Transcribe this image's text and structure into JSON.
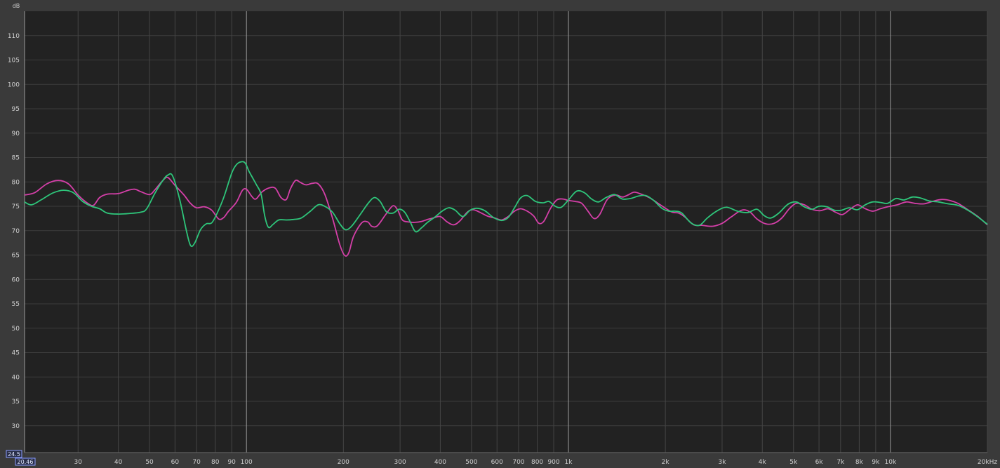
{
  "chart_data": {
    "type": "line",
    "xscale": "log",
    "xlim": [
      20.46,
      20000
    ],
    "ylim": [
      24.5,
      115
    ],
    "ylabel": "dB",
    "grid": true,
    "ytick_values": [
      30,
      35,
      40,
      45,
      50,
      55,
      60,
      65,
      70,
      75,
      80,
      85,
      90,
      95,
      100,
      105,
      110
    ],
    "ytick_labels": [
      "30",
      "35",
      "40",
      "45",
      "50",
      "55",
      "60",
      "65",
      "70",
      "75",
      "80",
      "85",
      "90",
      "95",
      "100",
      "105",
      "110"
    ],
    "xticks": [
      {
        "v": 30,
        "label": "30"
      },
      {
        "v": 40,
        "label": "40"
      },
      {
        "v": 50,
        "label": "50"
      },
      {
        "v": 60,
        "label": "60"
      },
      {
        "v": 70,
        "label": "70"
      },
      {
        "v": 80,
        "label": "80"
      },
      {
        "v": 90,
        "label": "90"
      },
      {
        "v": 100,
        "label": "100"
      },
      {
        "v": 200,
        "label": "200"
      },
      {
        "v": 300,
        "label": "300"
      },
      {
        "v": 400,
        "label": "400"
      },
      {
        "v": 500,
        "label": "500"
      },
      {
        "v": 600,
        "label": "600"
      },
      {
        "v": 700,
        "label": "700"
      },
      {
        "v": 800,
        "label": "800"
      },
      {
        "v": 900,
        "label": "900"
      },
      {
        "v": 1000,
        "label": "1k"
      },
      {
        "v": 2000,
        "label": "2k"
      },
      {
        "v": 3000,
        "label": "3k"
      },
      {
        "v": 4000,
        "label": "4k"
      },
      {
        "v": 5000,
        "label": "5k"
      },
      {
        "v": 6000,
        "label": "6k"
      },
      {
        "v": 7000,
        "label": "7k"
      },
      {
        "v": 8000,
        "label": "8k"
      },
      {
        "v": 9000,
        "label": "9k"
      },
      {
        "v": 10000,
        "label": "10k"
      },
      {
        "v": 20000,
        "label": "20kHz"
      }
    ],
    "major_x": [
      100,
      1000,
      10000
    ],
    "series": [
      {
        "color": "#d43fa8",
        "points": [
          [
            20.46,
            77.3
          ],
          [
            22,
            77.8
          ],
          [
            24,
            79.6
          ],
          [
            26,
            80.3
          ],
          [
            28,
            79.6
          ],
          [
            30,
            77.3
          ],
          [
            32,
            75.7
          ],
          [
            33.5,
            75.2
          ],
          [
            35,
            76.8
          ],
          [
            37,
            77.5
          ],
          [
            40,
            77.6
          ],
          [
            43,
            78.3
          ],
          [
            45,
            78.5
          ],
          [
            47,
            78.0
          ],
          [
            50,
            77.4
          ],
          [
            52,
            78.4
          ],
          [
            55,
            80.3
          ],
          [
            57,
            80.9
          ],
          [
            60,
            79.3
          ],
          [
            64,
            77.3
          ],
          [
            67,
            75.6
          ],
          [
            70,
            74.7
          ],
          [
            74,
            74.9
          ],
          [
            78,
            74.2
          ],
          [
            82,
            72.4
          ],
          [
            85,
            72.7
          ],
          [
            88,
            74.0
          ],
          [
            93,
            75.8
          ],
          [
            97,
            78.2
          ],
          [
            100,
            78.5
          ],
          [
            104,
            77.0
          ],
          [
            107,
            76.5
          ],
          [
            112,
            78.0
          ],
          [
            118,
            78.8
          ],
          [
            123,
            78.7
          ],
          [
            128,
            76.8
          ],
          [
            133,
            76.4
          ],
          [
            137,
            78.6
          ],
          [
            142,
            80.3
          ],
          [
            147,
            79.9
          ],
          [
            153,
            79.4
          ],
          [
            160,
            79.7
          ],
          [
            167,
            79.6
          ],
          [
            175,
            77.5
          ],
          [
            185,
            72.6
          ],
          [
            195,
            67.1
          ],
          [
            202,
            64.9
          ],
          [
            208,
            65.5
          ],
          [
            215,
            68.8
          ],
          [
            228,
            71.6
          ],
          [
            238,
            71.8
          ],
          [
            245,
            70.9
          ],
          [
            255,
            71.0
          ],
          [
            270,
            73.2
          ],
          [
            285,
            75.1
          ],
          [
            295,
            74.2
          ],
          [
            305,
            72.2
          ],
          [
            318,
            71.8
          ],
          [
            333,
            71.7
          ],
          [
            350,
            71.9
          ],
          [
            365,
            72.3
          ],
          [
            380,
            72.6
          ],
          [
            400,
            72.9
          ],
          [
            420,
            71.8
          ],
          [
            440,
            71.2
          ],
          [
            460,
            72.0
          ],
          [
            485,
            73.8
          ],
          [
            505,
            74.3
          ],
          [
            530,
            73.8
          ],
          [
            560,
            73.0
          ],
          [
            590,
            72.6
          ],
          [
            620,
            72.2
          ],
          [
            650,
            72.9
          ],
          [
            680,
            74.0
          ],
          [
            710,
            74.5
          ],
          [
            745,
            74.0
          ],
          [
            780,
            73.0
          ],
          [
            810,
            71.5
          ],
          [
            840,
            72.0
          ],
          [
            880,
            74.6
          ],
          [
            920,
            76.3
          ],
          [
            960,
            76.5
          ],
          [
            1000,
            76.2
          ],
          [
            1050,
            76.0
          ],
          [
            1100,
            75.6
          ],
          [
            1150,
            74.0
          ],
          [
            1200,
            72.5
          ],
          [
            1250,
            73.3
          ],
          [
            1320,
            76.4
          ],
          [
            1400,
            77.3
          ],
          [
            1470,
            76.9
          ],
          [
            1530,
            77.3
          ],
          [
            1600,
            77.9
          ],
          [
            1680,
            77.5
          ],
          [
            1780,
            76.8
          ],
          [
            1880,
            75.8
          ],
          [
            1990,
            74.7
          ],
          [
            2100,
            73.8
          ],
          [
            2200,
            73.6
          ],
          [
            2300,
            72.8
          ],
          [
            2450,
            71.2
          ],
          [
            2600,
            71.1
          ],
          [
            2800,
            70.9
          ],
          [
            3000,
            71.5
          ],
          [
            3200,
            72.8
          ],
          [
            3450,
            74.2
          ],
          [
            3650,
            73.9
          ],
          [
            3850,
            72.4
          ],
          [
            4100,
            71.4
          ],
          [
            4350,
            71.5
          ],
          [
            4600,
            72.6
          ],
          [
            4850,
            74.5
          ],
          [
            5100,
            75.6
          ],
          [
            5400,
            75.3
          ],
          [
            5700,
            74.4
          ],
          [
            6050,
            74.1
          ],
          [
            6400,
            74.5
          ],
          [
            6750,
            73.8
          ],
          [
            7100,
            73.3
          ],
          [
            7500,
            74.4
          ],
          [
            7900,
            75.3
          ],
          [
            8300,
            74.6
          ],
          [
            8800,
            74.0
          ],
          [
            9300,
            74.5
          ],
          [
            9800,
            74.9
          ],
          [
            10500,
            75.3
          ],
          [
            11200,
            75.9
          ],
          [
            11900,
            75.6
          ],
          [
            12700,
            75.5
          ],
          [
            13500,
            76.0
          ],
          [
            14400,
            76.4
          ],
          [
            15300,
            76.2
          ],
          [
            16200,
            75.6
          ],
          [
            17300,
            74.4
          ],
          [
            18600,
            73.0
          ],
          [
            20000,
            71.2
          ]
        ]
      },
      {
        "color": "#2ec57a",
        "points": [
          [
            20.46,
            75.9
          ],
          [
            21.5,
            75.3
          ],
          [
            23,
            76.3
          ],
          [
            25,
            77.7
          ],
          [
            27,
            78.3
          ],
          [
            29,
            77.8
          ],
          [
            31,
            76.0
          ],
          [
            33,
            75.0
          ],
          [
            35,
            74.5
          ],
          [
            37,
            73.6
          ],
          [
            40,
            73.4
          ],
          [
            43,
            73.5
          ],
          [
            47,
            73.8
          ],
          [
            49,
            74.5
          ],
          [
            52,
            77.7
          ],
          [
            55,
            80.3
          ],
          [
            57,
            81.4
          ],
          [
            59,
            81.2
          ],
          [
            62,
            76.5
          ],
          [
            65,
            70.2
          ],
          [
            67,
            67.0
          ],
          [
            69,
            67.4
          ],
          [
            72,
            70.2
          ],
          [
            75,
            71.4
          ],
          [
            78,
            71.6
          ],
          [
            81,
            73.5
          ],
          [
            85,
            76.8
          ],
          [
            90,
            81.8
          ],
          [
            93,
            83.5
          ],
          [
            96,
            84.1
          ],
          [
            99,
            83.9
          ],
          [
            102,
            82.1
          ],
          [
            107,
            79.6
          ],
          [
            111,
            77.5
          ],
          [
            114,
            73.0
          ],
          [
            117,
            70.7
          ],
          [
            121,
            71.3
          ],
          [
            126,
            72.2
          ],
          [
            133,
            72.2
          ],
          [
            140,
            72.3
          ],
          [
            148,
            72.6
          ],
          [
            158,
            74.0
          ],
          [
            167,
            75.3
          ],
          [
            175,
            75.0
          ],
          [
            185,
            73.8
          ],
          [
            195,
            71.4
          ],
          [
            203,
            70.2
          ],
          [
            212,
            70.9
          ],
          [
            225,
            73.2
          ],
          [
            240,
            75.8
          ],
          [
            250,
            76.8
          ],
          [
            260,
            76.0
          ],
          [
            272,
            73.9
          ],
          [
            285,
            73.6
          ],
          [
            298,
            74.4
          ],
          [
            310,
            73.8
          ],
          [
            322,
            71.9
          ],
          [
            335,
            69.8
          ],
          [
            350,
            70.6
          ],
          [
            365,
            71.7
          ],
          [
            385,
            72.8
          ],
          [
            405,
            74.0
          ],
          [
            425,
            74.7
          ],
          [
            445,
            74.2
          ],
          [
            470,
            72.9
          ],
          [
            495,
            74.2
          ],
          [
            520,
            74.6
          ],
          [
            550,
            74.1
          ],
          [
            585,
            72.7
          ],
          [
            620,
            72.1
          ],
          [
            650,
            72.7
          ],
          [
            680,
            74.7
          ],
          [
            710,
            76.7
          ],
          [
            745,
            77.2
          ],
          [
            790,
            76.0
          ],
          [
            835,
            75.7
          ],
          [
            870,
            76.0
          ],
          [
            910,
            75.0
          ],
          [
            950,
            74.8
          ],
          [
            1000,
            76.3
          ],
          [
            1060,
            78.1
          ],
          [
            1120,
            77.8
          ],
          [
            1180,
            76.5
          ],
          [
            1240,
            75.9
          ],
          [
            1310,
            76.8
          ],
          [
            1390,
            77.4
          ],
          [
            1470,
            76.5
          ],
          [
            1560,
            76.6
          ],
          [
            1650,
            77.1
          ],
          [
            1740,
            77.2
          ],
          [
            1840,
            76.2
          ],
          [
            1950,
            74.6
          ],
          [
            2050,
            74.0
          ],
          [
            2150,
            74.0
          ],
          [
            2250,
            73.6
          ],
          [
            2400,
            71.6
          ],
          [
            2550,
            71.1
          ],
          [
            2700,
            72.6
          ],
          [
            2900,
            74.1
          ],
          [
            3100,
            74.8
          ],
          [
            3350,
            74.0
          ],
          [
            3600,
            73.7
          ],
          [
            3850,
            74.4
          ],
          [
            4050,
            73.1
          ],
          [
            4250,
            72.6
          ],
          [
            4500,
            73.6
          ],
          [
            4800,
            75.4
          ],
          [
            5100,
            75.9
          ],
          [
            5400,
            74.9
          ],
          [
            5700,
            74.4
          ],
          [
            6000,
            75.0
          ],
          [
            6350,
            74.9
          ],
          [
            6700,
            74.2
          ],
          [
            7050,
            74.2
          ],
          [
            7450,
            74.7
          ],
          [
            7900,
            74.3
          ],
          [
            8350,
            75.3
          ],
          [
            8800,
            75.9
          ],
          [
            9300,
            75.8
          ],
          [
            9800,
            75.6
          ],
          [
            10400,
            76.6
          ],
          [
            11000,
            76.3
          ],
          [
            11700,
            76.9
          ],
          [
            12400,
            76.7
          ],
          [
            13200,
            76.1
          ],
          [
            14100,
            75.9
          ],
          [
            15100,
            75.5
          ],
          [
            16200,
            75.2
          ],
          [
            17400,
            74.2
          ],
          [
            18700,
            72.8
          ],
          [
            20000,
            71.3
          ]
        ]
      }
    ]
  },
  "readout": {
    "y_value": "24.5",
    "x_value": "20.46"
  }
}
